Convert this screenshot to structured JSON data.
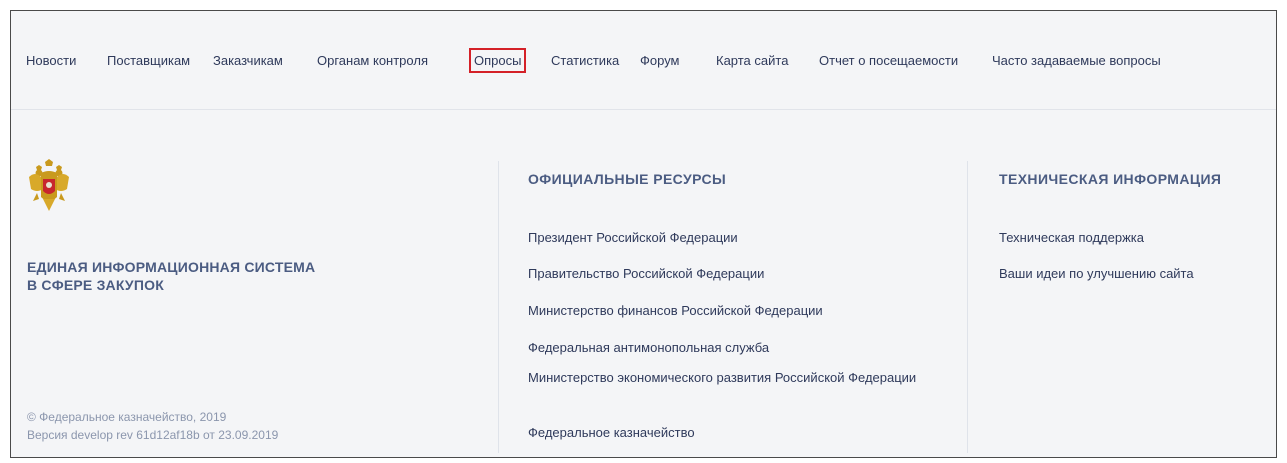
{
  "nav": {
    "items": [
      {
        "label": "Новости"
      },
      {
        "label": "Поставщикам"
      },
      {
        "label": "Заказчикам"
      },
      {
        "label": "Органам контроля"
      },
      {
        "label": "Опросы",
        "highlighted": true
      },
      {
        "label": "Статистика"
      },
      {
        "label": "Форум"
      },
      {
        "label": "Карта сайта"
      },
      {
        "label": "Отчет о посещаемости"
      },
      {
        "label": "Часто задаваемые вопросы"
      }
    ],
    "highlight_color": "#d42128"
  },
  "left": {
    "title_line1": "ЕДИНАЯ ИНФОРМАЦИОННАЯ СИСТЕМА",
    "title_line2": "В СФЕРЕ ЗАКУПОК",
    "copyright": "© Федеральное казначейство, 2019",
    "version": "Версия develop rev 61d12af18b от 23.09.2019"
  },
  "official": {
    "heading": "ОФИЦИАЛЬНЫЕ РЕСУРСЫ",
    "links": [
      "Президент Российской Федерации",
      "Правительство Российской Федерации",
      "Министерство финансов Российской Федерации",
      "Федеральная антимонопольная служба",
      "Министерство экономического развития Российской Федерации",
      "Федеральное казначейство"
    ]
  },
  "tech": {
    "heading": "ТЕХНИЧЕСКАЯ ИНФОРМАЦИЯ",
    "links": [
      "Техническая поддержка",
      "Ваши идеи по улучшению сайта"
    ]
  },
  "colors": {
    "text": "#2f3a5b",
    "heading": "#4b5c82",
    "muted": "#8b96ad",
    "background": "#f4f5f7"
  }
}
